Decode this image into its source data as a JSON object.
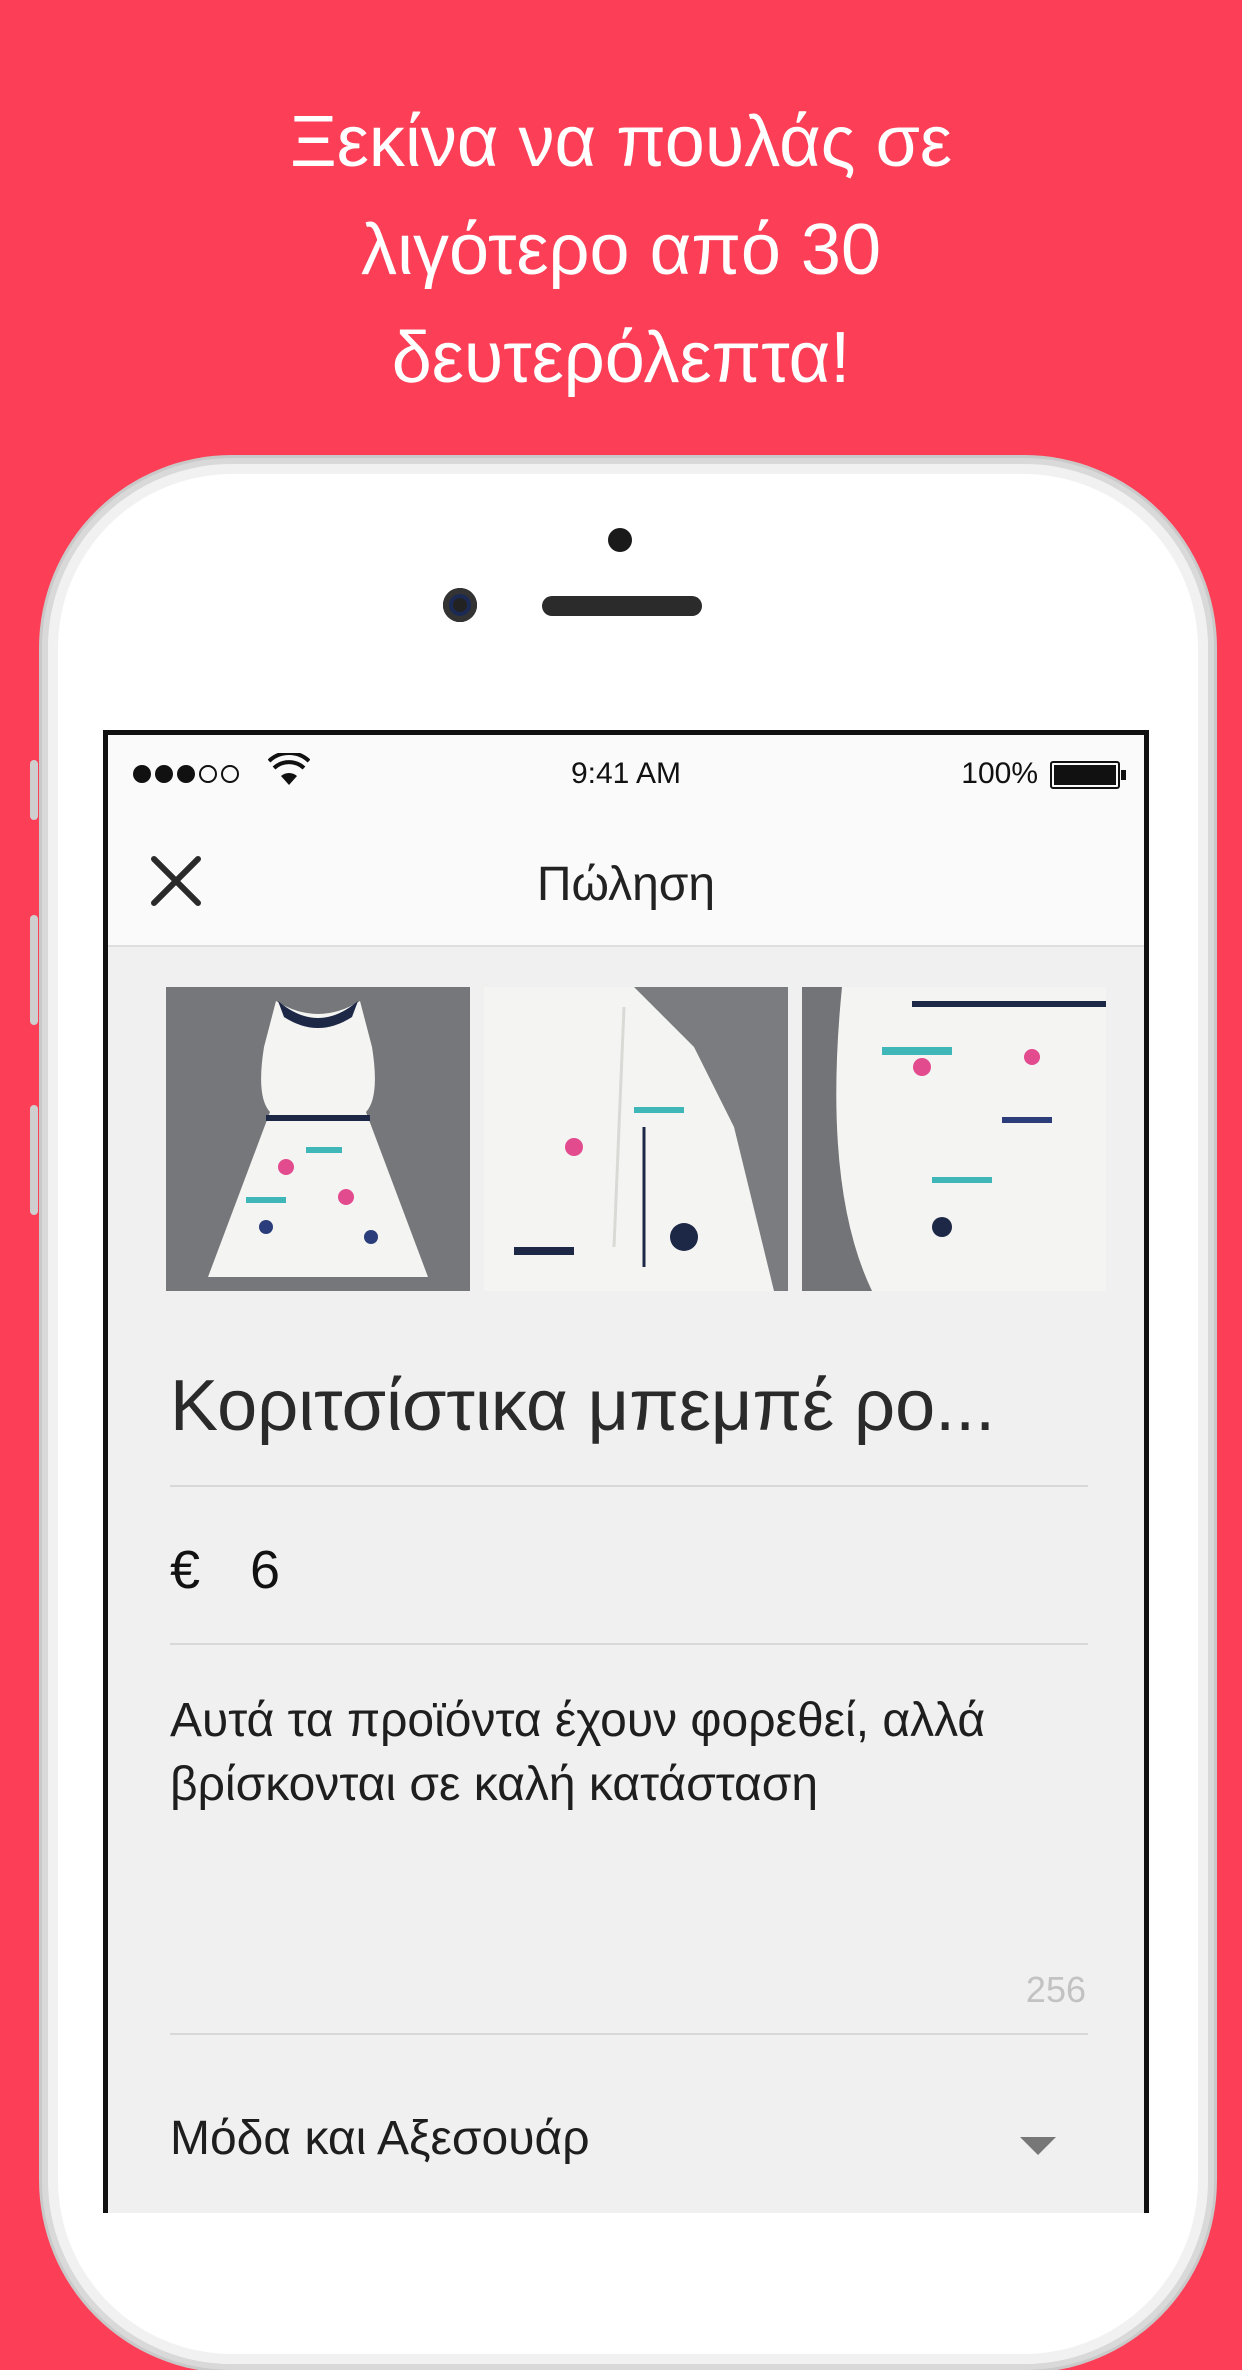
{
  "headline": {
    "line1": "Ξεκίνα να πουλάς σε",
    "line2": "λιγότερο από 30",
    "line3": "δευτερόλεπτα!"
  },
  "statusbar": {
    "time": "9:41 AM",
    "battery": "100%",
    "signal_icon": "signal-dots-icon",
    "wifi_icon": "wifi-icon"
  },
  "nav": {
    "title": "Πώληση",
    "close_icon": "close-icon"
  },
  "photos": [
    "dress-photo-front",
    "dress-photo-back",
    "dress-photo-detail"
  ],
  "form": {
    "title": "Κοριτσίστικα μπεμπέ ρο...",
    "currency": "€",
    "price": "6",
    "description": "Αυτά τα προϊόντα έχουν φορεθεί, αλλά βρίσκονται σε καλή κατάσταση",
    "char_count": "256",
    "category": "Μόδα και Αξεσουάρ"
  },
  "colors": {
    "brand": "#fc3e56",
    "screen_bg": "#f0f0f0"
  }
}
